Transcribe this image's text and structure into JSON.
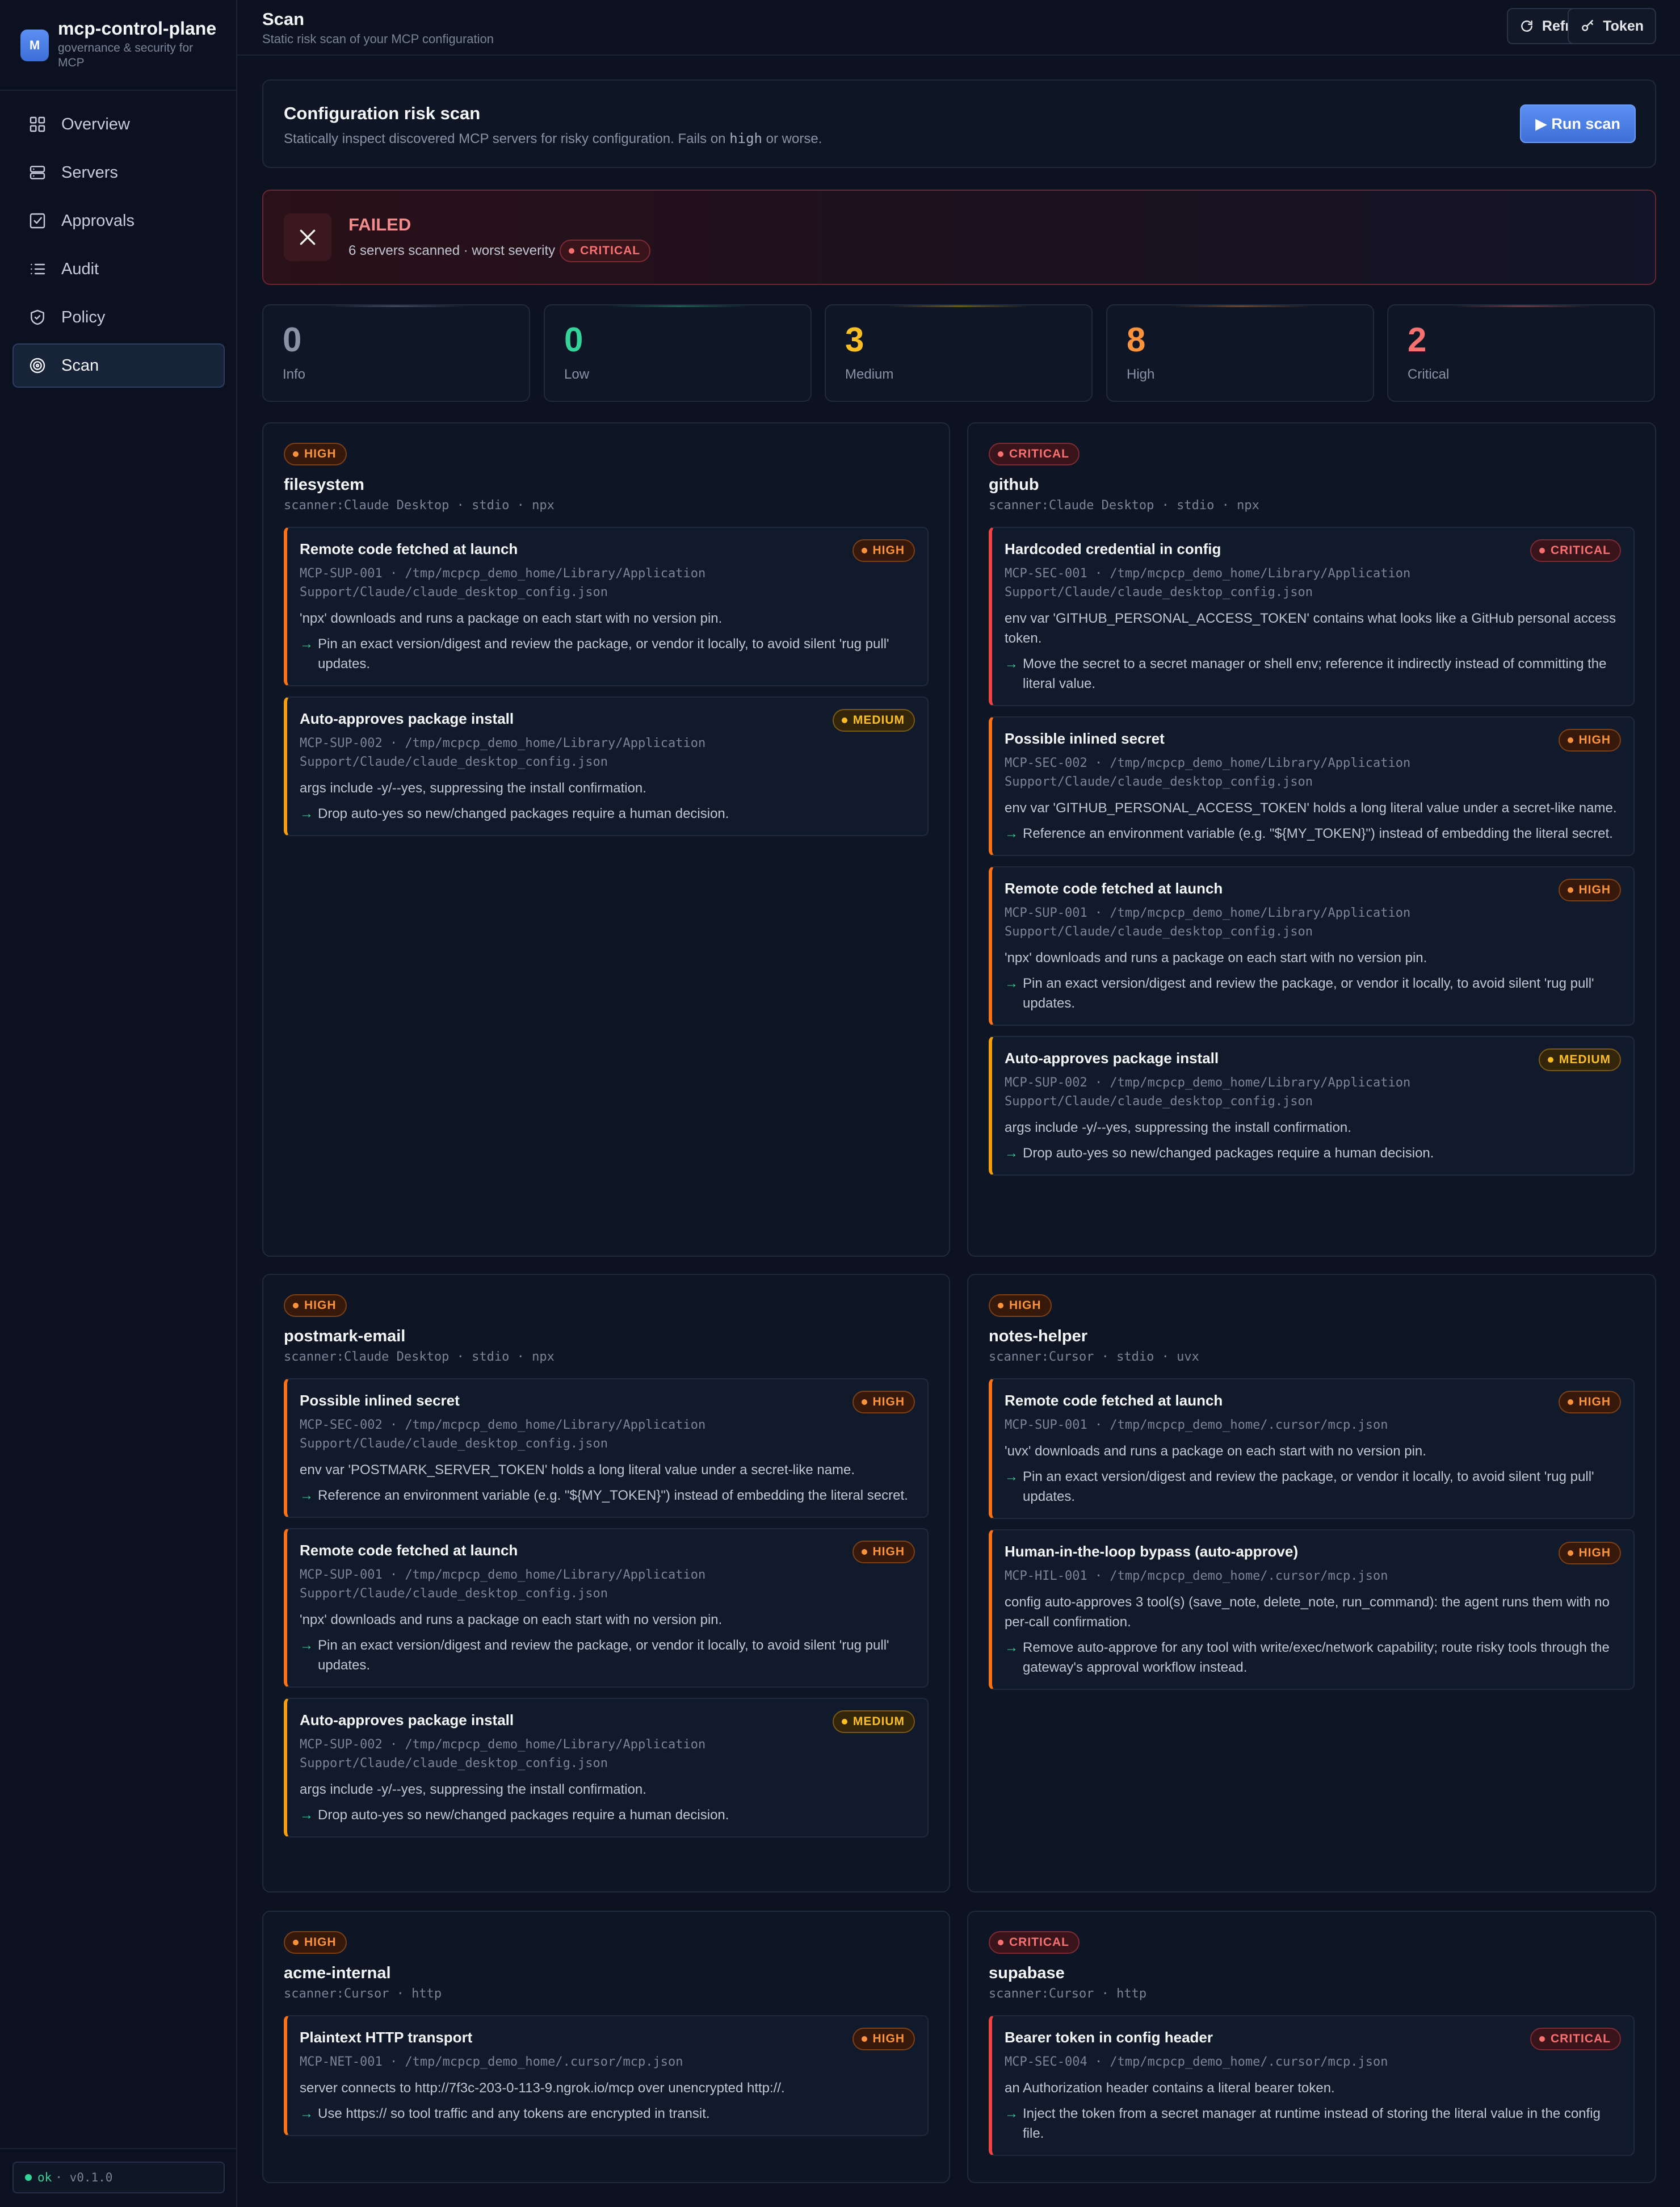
{
  "app": {
    "name": "mcp-control-plane",
    "tagline": "governance & security for MCP",
    "logo": "M"
  },
  "nav": [
    {
      "id": "overview",
      "label": "Overview",
      "icon": "grid-icon"
    },
    {
      "id": "servers",
      "label": "Servers",
      "icon": "server-icon"
    },
    {
      "id": "approvals",
      "label": "Approvals",
      "icon": "checkbox-icon"
    },
    {
      "id": "audit",
      "label": "Audit",
      "icon": "list-icon"
    },
    {
      "id": "policy",
      "label": "Policy",
      "icon": "shield-icon"
    },
    {
      "id": "scan",
      "label": "Scan",
      "icon": "target-icon",
      "active": true
    }
  ],
  "status": {
    "state": "ok",
    "version": "· v0.1.0"
  },
  "header": {
    "title": "Scan",
    "subtitle": "Static risk scan of your MCP configuration",
    "refresh_label": "Refresh",
    "token_label": "Token"
  },
  "config": {
    "title": "Configuration risk scan",
    "desc_before": "Statically inspect discovered MCP servers for risky configuration. Fails on ",
    "desc_code": "high",
    "desc_after": " or worse.",
    "run_label": "▶ Run scan"
  },
  "result": {
    "status": "FAILED",
    "summary": "6 servers scanned · worst severity",
    "worst": "CRITICAL"
  },
  "stats": [
    {
      "label": "Info",
      "value": "0",
      "color": "#8a93a5"
    },
    {
      "label": "Low",
      "value": "0",
      "color": "#34d399"
    },
    {
      "label": "Medium",
      "value": "3",
      "color": "#fbbf24"
    },
    {
      "label": "High",
      "value": "8",
      "color": "#fb923c"
    },
    {
      "label": "Critical",
      "value": "2",
      "color": "#f87171"
    }
  ],
  "servers": [
    {
      "name": "filesystem",
      "severity": "HIGH",
      "meta": "scanner:Claude Desktop · stdio · npx",
      "findings": [
        {
          "title": "Remote code fetched at launch",
          "severity": "HIGH",
          "id": "MCP-SUP-001 · /tmp/mcpcp_demo_home/Library/Application Support/Claude/claude_desktop_config.json",
          "desc": "'npx' downloads and runs a package on each start with no version pin.",
          "rec": "Pin an exact version/digest and review the package, or vendor it locally, to avoid silent 'rug pull' updates."
        },
        {
          "title": "Auto-approves package install",
          "severity": "MEDIUM",
          "id": "MCP-SUP-002 · /tmp/mcpcp_demo_home/Library/Application Support/Claude/claude_desktop_config.json",
          "desc": "args include -y/--yes, suppressing the install confirmation.",
          "rec": "Drop auto-yes so new/changed packages require a human decision."
        }
      ]
    },
    {
      "name": "github",
      "severity": "CRITICAL",
      "meta": "scanner:Claude Desktop · stdio · npx",
      "findings": [
        {
          "title": "Hardcoded credential in config",
          "severity": "CRITICAL",
          "id": "MCP-SEC-001 · /tmp/mcpcp_demo_home/Library/Application Support/Claude/claude_desktop_config.json",
          "desc": "env var 'GITHUB_PERSONAL_ACCESS_TOKEN' contains what looks like a GitHub personal access token.",
          "rec": "Move the secret to a secret manager or shell env; reference it indirectly instead of committing the literal value."
        },
        {
          "title": "Possible inlined secret",
          "severity": "HIGH",
          "id": "MCP-SEC-002 · /tmp/mcpcp_demo_home/Library/Application Support/Claude/claude_desktop_config.json",
          "desc": "env var 'GITHUB_PERSONAL_ACCESS_TOKEN' holds a long literal value under a secret-like name.",
          "rec": "Reference an environment variable (e.g. \"${MY_TOKEN}\") instead of embedding the literal secret."
        },
        {
          "title": "Remote code fetched at launch",
          "severity": "HIGH",
          "id": "MCP-SUP-001 · /tmp/mcpcp_demo_home/Library/Application Support/Claude/claude_desktop_config.json",
          "desc": "'npx' downloads and runs a package on each start with no version pin.",
          "rec": "Pin an exact version/digest and review the package, or vendor it locally, to avoid silent 'rug pull' updates."
        },
        {
          "title": "Auto-approves package install",
          "severity": "MEDIUM",
          "id": "MCP-SUP-002 · /tmp/mcpcp_demo_home/Library/Application Support/Claude/claude_desktop_config.json",
          "desc": "args include -y/--yes, suppressing the install confirmation.",
          "rec": "Drop auto-yes so new/changed packages require a human decision."
        }
      ]
    },
    {
      "name": "postmark-email",
      "severity": "HIGH",
      "meta": "scanner:Claude Desktop · stdio · npx",
      "findings": [
        {
          "title": "Possible inlined secret",
          "severity": "HIGH",
          "id": "MCP-SEC-002 · /tmp/mcpcp_demo_home/Library/Application Support/Claude/claude_desktop_config.json",
          "desc": "env var 'POSTMARK_SERVER_TOKEN' holds a long literal value under a secret-like name.",
          "rec": "Reference an environment variable (e.g. \"${MY_TOKEN}\") instead of embedding the literal secret."
        },
        {
          "title": "Remote code fetched at launch",
          "severity": "HIGH",
          "id": "MCP-SUP-001 · /tmp/mcpcp_demo_home/Library/Application Support/Claude/claude_desktop_config.json",
          "desc": "'npx' downloads and runs a package on each start with no version pin.",
          "rec": "Pin an exact version/digest and review the package, or vendor it locally, to avoid silent 'rug pull' updates."
        },
        {
          "title": "Auto-approves package install",
          "severity": "MEDIUM",
          "id": "MCP-SUP-002 · /tmp/mcpcp_demo_home/Library/Application Support/Claude/claude_desktop_config.json",
          "desc": "args include -y/--yes, suppressing the install confirmation.",
          "rec": "Drop auto-yes so new/changed packages require a human decision."
        }
      ]
    },
    {
      "name": "notes-helper",
      "severity": "HIGH",
      "meta": "scanner:Cursor · stdio · uvx",
      "findings": [
        {
          "title": "Remote code fetched at launch",
          "severity": "HIGH",
          "id": "MCP-SUP-001 · /tmp/mcpcp_demo_home/.cursor/mcp.json",
          "desc": "'uvx' downloads and runs a package on each start with no version pin.",
          "rec": "Pin an exact version/digest and review the package, or vendor it locally, to avoid silent 'rug pull' updates."
        },
        {
          "title": "Human-in-the-loop bypass (auto-approve)",
          "severity": "HIGH",
          "id": "MCP-HIL-001 · /tmp/mcpcp_demo_home/.cursor/mcp.json",
          "desc": "config auto-approves 3 tool(s) (save_note, delete_note, run_command): the agent runs them with no per-call confirmation.",
          "rec": "Remove auto-approve for any tool with write/exec/network capability; route risky tools through the gateway's approval workflow instead."
        }
      ]
    },
    {
      "name": "acme-internal",
      "severity": "HIGH",
      "meta": "scanner:Cursor · http",
      "findings": [
        {
          "title": "Plaintext HTTP transport",
          "severity": "HIGH",
          "id": "MCP-NET-001 · /tmp/mcpcp_demo_home/.cursor/mcp.json",
          "desc": "server connects to http://7f3c-203-0-113-9.ngrok.io/mcp over unencrypted http://.",
          "rec": "Use https:// so tool traffic and any tokens are encrypted in transit."
        }
      ]
    },
    {
      "name": "supabase",
      "severity": "CRITICAL",
      "meta": "scanner:Cursor · http",
      "findings": [
        {
          "title": "Bearer token in config header",
          "severity": "CRITICAL",
          "id": "MCP-SEC-004 · /tmp/mcpcp_demo_home/.cursor/mcp.json",
          "desc": "an Authorization header contains a literal bearer token.",
          "rec": "Inject the token from a secret manager at runtime instead of storing the literal value in the config file."
        }
      ]
    }
  ]
}
